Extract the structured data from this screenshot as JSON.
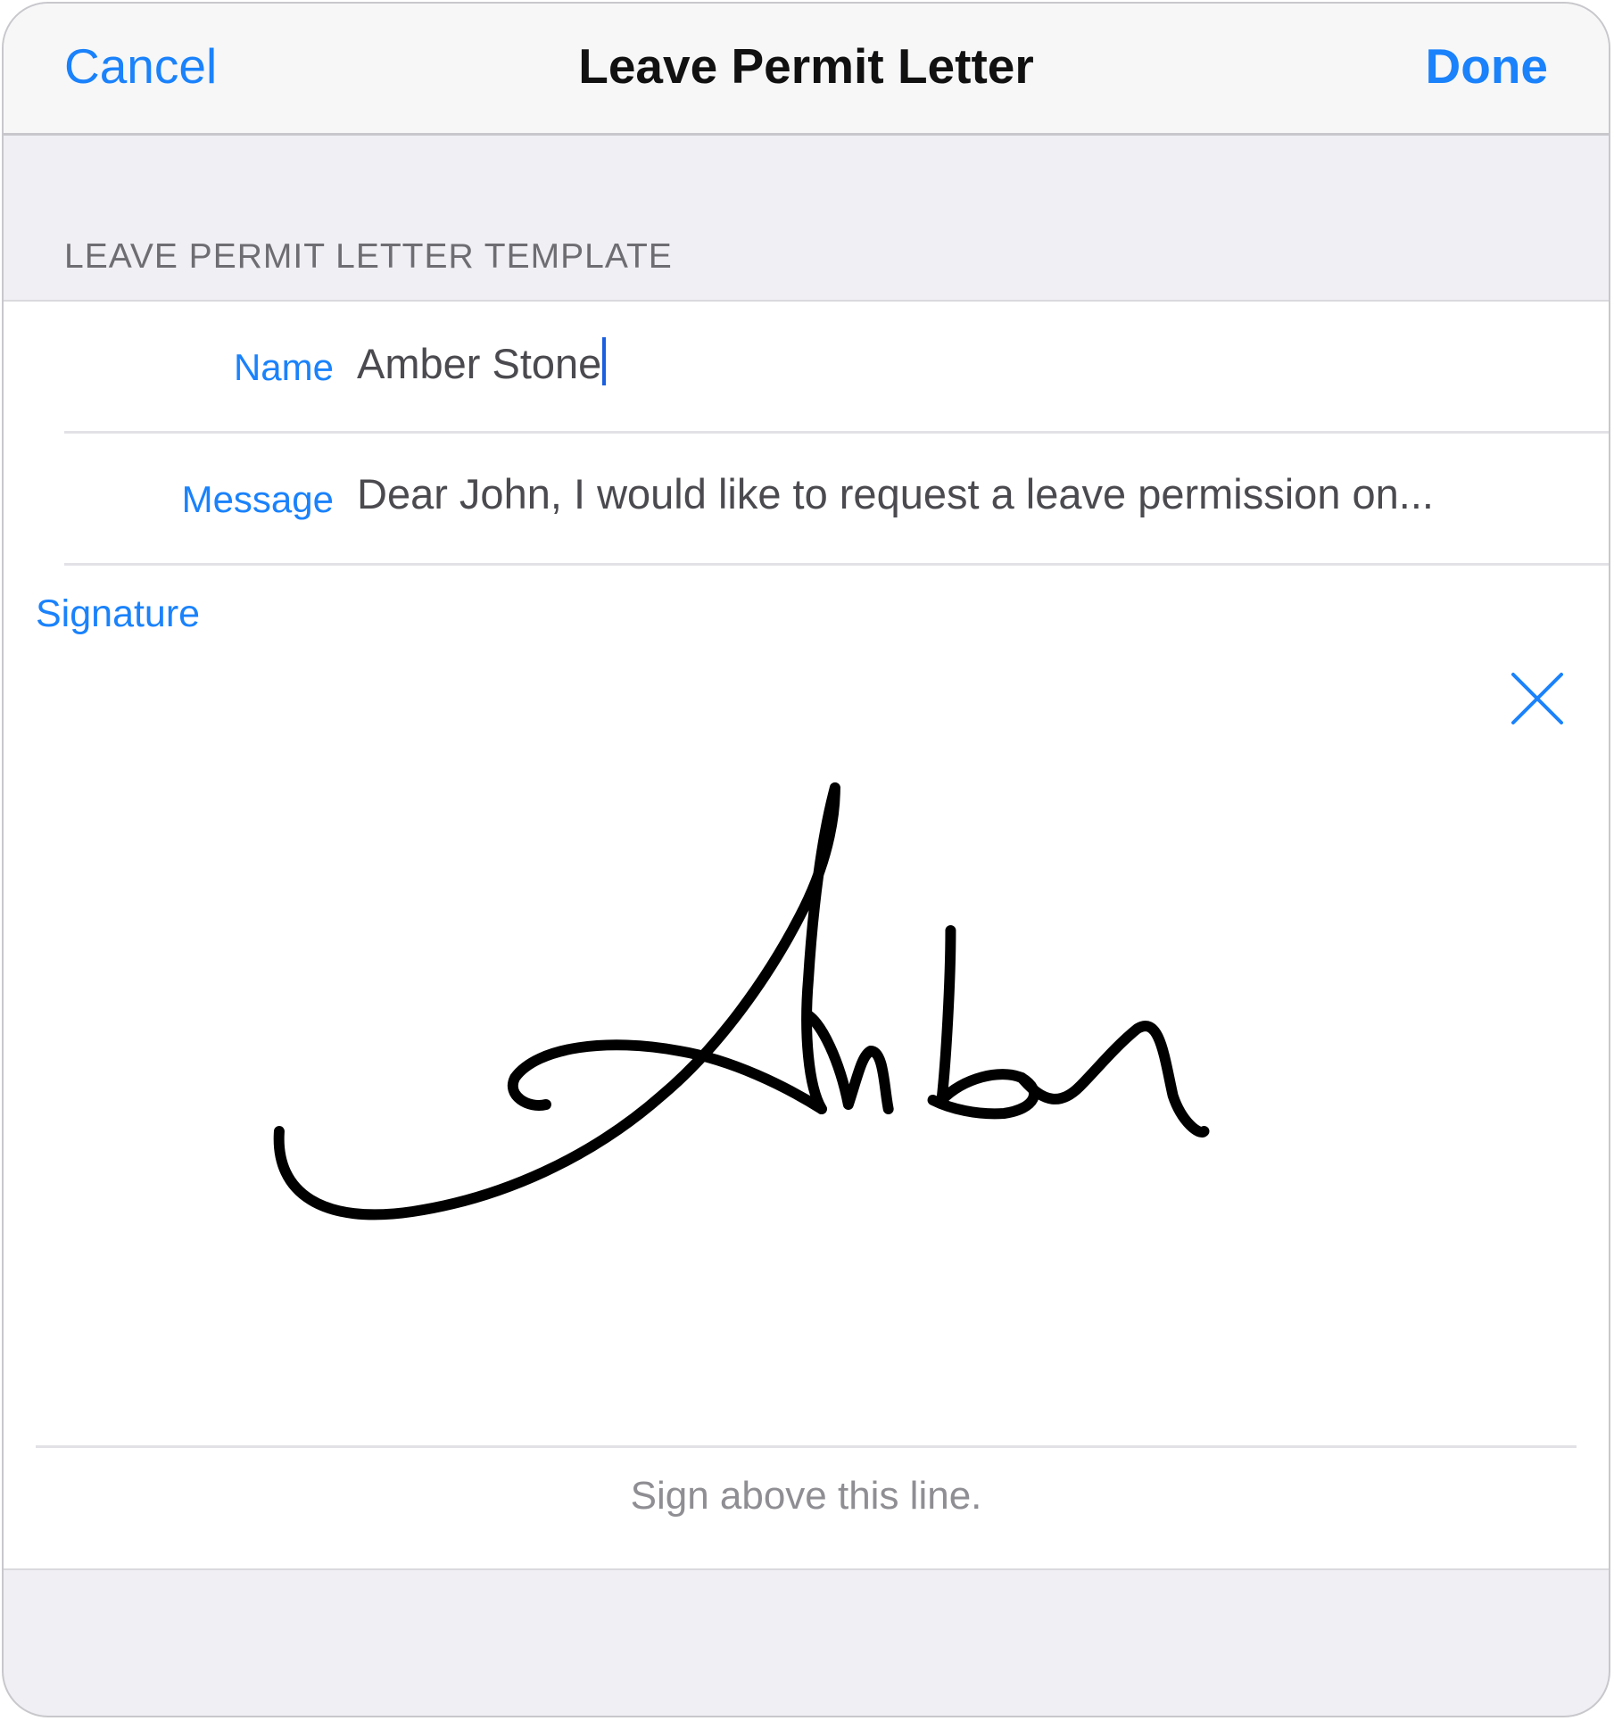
{
  "navbar": {
    "cancel_label": "Cancel",
    "title": "Leave Permit Letter",
    "done_label": "Done"
  },
  "section": {
    "header": "LEAVE PERMIT LETTER TEMPLATE"
  },
  "form": {
    "name": {
      "label": "Name",
      "value": "Amber Stone"
    },
    "message": {
      "label": "Message",
      "value": "Dear John, I would like to request a leave permission on..."
    },
    "signature": {
      "label": "Signature",
      "signature_text": "Amber",
      "clear_icon": "close-icon",
      "hint": "Sign above this line."
    }
  },
  "colors": {
    "accent": "#1a82fb",
    "background": "#efeff4",
    "ink": "#000000"
  }
}
